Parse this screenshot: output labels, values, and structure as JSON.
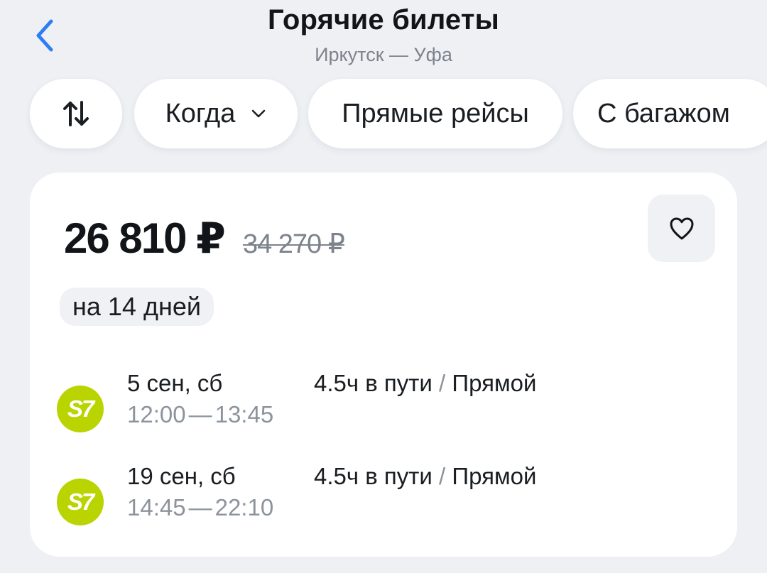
{
  "header": {
    "title": "Горячие билеты",
    "subtitle": "Иркутск — Уфа",
    "back_icon": "chevron-left-icon"
  },
  "filters": {
    "sort_icon": "sort-arrows-icon",
    "when_label": "Когда",
    "when_icon": "chevron-down-icon",
    "direct_label": "Прямые рейсы",
    "baggage_label": "С багажом"
  },
  "offer": {
    "price": "26 810 ₽",
    "old_price": "34 270 ₽",
    "duration": "на 14 дней",
    "favorite_icon": "heart-icon",
    "flights": [
      {
        "airline_logo": "S7",
        "date": "5 сен, сб",
        "depart": "12:00",
        "dash": "—",
        "arrive": "13:45",
        "travel_time": "4.5ч в пути",
        "sep": "/",
        "type": "Прямой"
      },
      {
        "airline_logo": "S7",
        "date": "19 сен, сб",
        "depart": "14:45",
        "dash": "—",
        "arrive": "22:10",
        "travel_time": "4.5ч в пути",
        "sep": "/",
        "type": "Прямой"
      }
    ]
  },
  "colors": {
    "background": "#eef0f4",
    "accent_blue": "#2f7df6",
    "s7_green": "#b9d400",
    "muted_text": "#7d838d"
  }
}
